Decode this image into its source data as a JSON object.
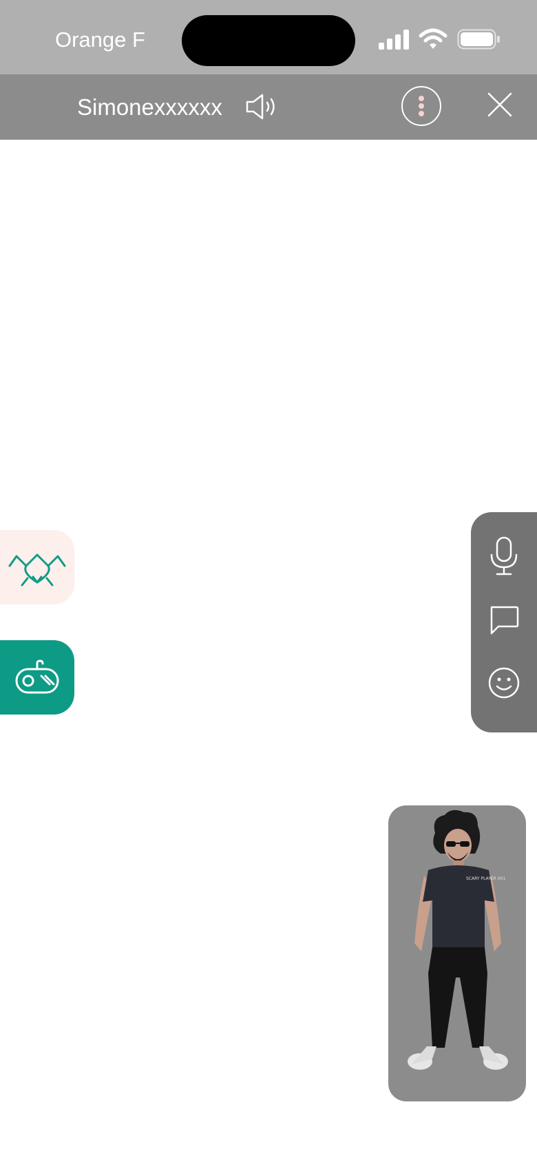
{
  "status_bar": {
    "carrier": "Orange F",
    "icons": [
      "signal-icon",
      "wifi-icon",
      "battery-icon"
    ]
  },
  "header": {
    "contact_name": "Simonexxxxxx",
    "icons": [
      "speaker-icon",
      "more-icon",
      "close-icon"
    ]
  },
  "left_tabs": [
    {
      "icon": "heart-hands-icon",
      "background": "#fcefec",
      "icon_color": "#0e9b85"
    },
    {
      "icon": "game-controller-icon",
      "background": "#0e9b85",
      "icon_color": "#ffffff"
    }
  ],
  "right_actions": [
    "microphone-icon",
    "chat-bubble-icon",
    "smiley-icon"
  ],
  "avatar_preview": {
    "shirt_text": "SCARY PLAYER 001"
  },
  "colors": {
    "accent": "#0e9b85",
    "status_bar": "#b0b0b0",
    "header": "#8c8c8c",
    "panel": "#737373"
  }
}
